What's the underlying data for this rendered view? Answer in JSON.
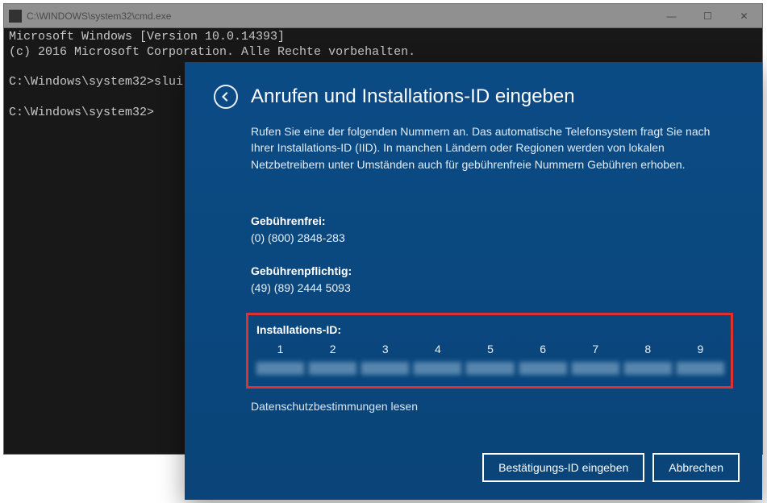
{
  "cmd": {
    "title": "C:\\WINDOWS\\system32\\cmd.exe",
    "line1": "Microsoft Windows [Version 10.0.14393]",
    "line2": "(c) 2016 Microsoft Corporation. Alle Rechte vorbehalten.",
    "line3": "C:\\Windows\\system32>slui",
    "line4": "C:\\Windows\\system32>"
  },
  "dialog": {
    "title": "Anrufen und Installations-ID eingeben",
    "desc": "Rufen Sie eine der folgenden Nummern an. Das automatische Telefonsystem fragt Sie nach Ihrer Installations-ID (IID). In manchen Ländern oder Regionen werden von lokalen Netzbetreibern unter Umständen auch für gebührenfreie Nummern Gebühren erhoben.",
    "free_label": "Gebührenfrei:",
    "free_number": "(0) (800) 2848-283",
    "paid_label": "Gebührenpflichtig:",
    "paid_number": "(49) (89) 2444 5093",
    "inst_label": "Installations-ID:",
    "cols": [
      "1",
      "2",
      "3",
      "4",
      "5",
      "6",
      "7",
      "8",
      "9"
    ],
    "privacy": "Datenschutzbestimmungen lesen",
    "confirm_btn": "Bestätigungs-ID eingeben",
    "cancel_btn": "Abbrechen"
  },
  "winbtns": {
    "min": "—",
    "max": "☐",
    "close": "✕"
  }
}
